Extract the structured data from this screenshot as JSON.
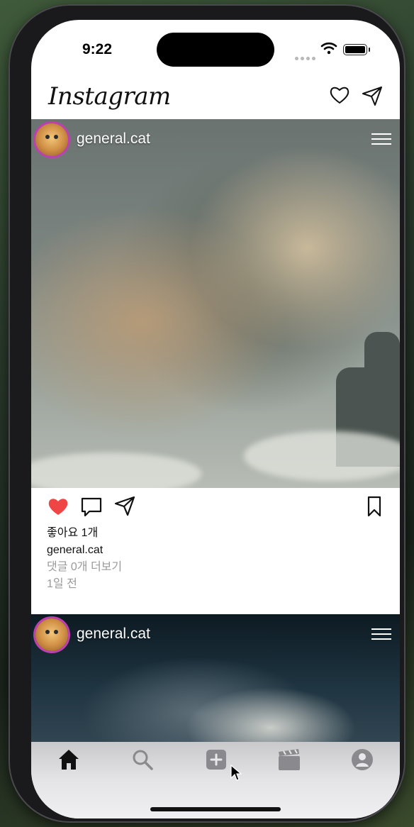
{
  "status_bar": {
    "time": "9:22"
  },
  "header": {
    "app_title": "Instagram",
    "icons": [
      "heart-icon",
      "send-icon"
    ]
  },
  "posts": [
    {
      "username": "general.cat",
      "image": "dragon-portrait-photo",
      "liked": true,
      "likes_text": "좋아요 1개",
      "caption_user": "general.cat",
      "comments_text": "댓글 0개 더보기",
      "time_ago": "1일 전"
    },
    {
      "username": "general.cat",
      "image": "dragon-photo-partial"
    }
  ],
  "tab_bar": {
    "items": [
      "home-icon",
      "search-icon",
      "add-icon",
      "reels-icon",
      "profile-icon"
    ],
    "active": "home-icon"
  },
  "colors": {
    "like_red": "#f04545",
    "avatar_ring": "#c03fb0",
    "tab_inactive": "#8a8a8e"
  }
}
